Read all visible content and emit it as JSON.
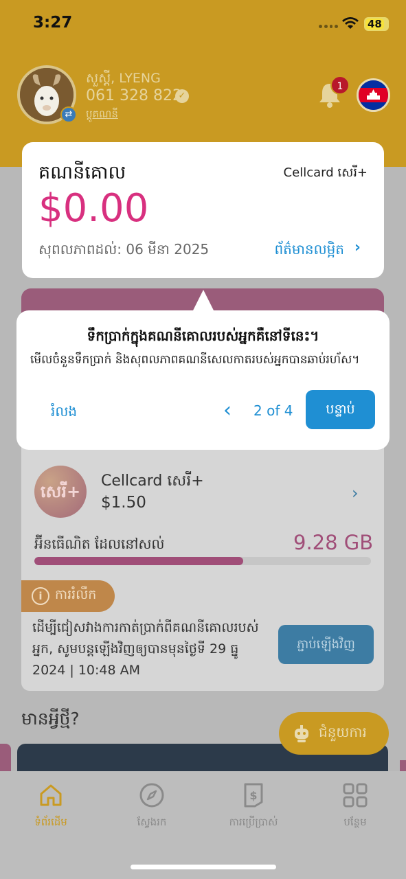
{
  "status_bar": {
    "time": "3:27",
    "battery": "48"
  },
  "profile": {
    "name": "សួស្ដី, LYENG",
    "phone": "061 328 822",
    "switch_label": "ប្ដូគណនី",
    "notification_count": "1"
  },
  "account_card": {
    "title": "គណនីគោល",
    "plan": "Cellcard សេរី+",
    "balance": "$0.00",
    "validity": "សុពលភាពដល់: 06 មីនា 2025",
    "details_link": "ព័ត៌មានលម្អិត"
  },
  "tooltip": {
    "title": "ទឹកប្រាក់ក្នុងគណនីគោលរបស់អ្នកគឺនៅទីនេះ។",
    "body": "មើលចំនួនទឹកប្រាក់ និងសុពលភាពគណនីសេលកាតរបស់អ្នកបានឆាប់រហ័ស។",
    "skip_label": "រំលង",
    "step": "2 of 4",
    "next_label": "បន្ទាប់"
  },
  "plan": {
    "logo_text": "សេរី+",
    "name": "Cellcard សេរី+",
    "price": "$1.50",
    "data_label": "អ៊ីនធើណិត ដែលនៅសល់",
    "data_value": "9.28 GB",
    "data_remaining_fraction": 0.62
  },
  "reminder": {
    "tag_label": "ការរំលឹក",
    "text": "ដើម្បីជៀសវាងការកាត់ប្រាក់ពីគណនីគោលរបស់អ្នក, សូមបន្តឡើងវិញឲ្យបានមុនថ្ងៃទី 29 ធ្នូ 2024 | 10:48 AM",
    "renew_label": "ភ្ជាប់ឡើងវិញ"
  },
  "whats_new": {
    "title": "មានអ្វីថ្មី?"
  },
  "help": {
    "label": "ជំនួយការ"
  },
  "tabs": [
    {
      "label": "ទំព័រដើម",
      "icon": "home-icon",
      "active": true
    },
    {
      "label": "ស្វែងរក",
      "icon": "compass-icon",
      "active": false
    },
    {
      "label": "ការប្រើប្រាស់",
      "icon": "usage-icon",
      "active": false
    },
    {
      "label": "បន្ថែម",
      "icon": "grid-icon",
      "active": false
    }
  ],
  "colors": {
    "header": "#c99a22",
    "balance": "#d8307f",
    "link": "#1f8fd3",
    "data": "#a04e78"
  }
}
